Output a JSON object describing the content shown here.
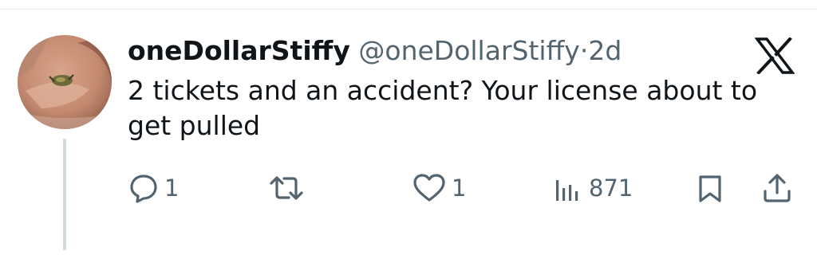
{
  "tweet": {
    "display_name": "oneDollarStiffy",
    "handle": "@oneDollarStiffy",
    "separator": "·",
    "time": "2d",
    "text": "2 tickets and an accident? Your license about to get pulled"
  },
  "actions": {
    "replies": "1",
    "reposts": "",
    "likes": "1",
    "views": "871"
  },
  "icons": {
    "reply": "reply-icon",
    "repost": "repost-icon",
    "like": "heart-icon",
    "views": "views-icon",
    "bookmark": "bookmark-icon",
    "share": "share-icon",
    "logo": "x-logo-icon"
  },
  "colors": {
    "text": "#0f1419",
    "secondary": "#536471",
    "thread_line": "#cfd9de"
  }
}
